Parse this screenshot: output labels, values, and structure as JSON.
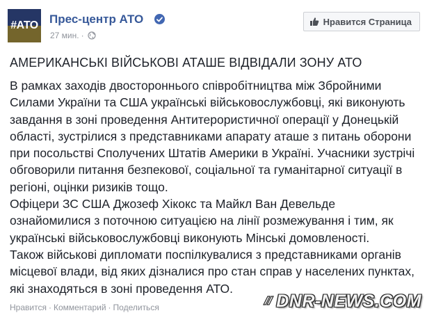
{
  "header": {
    "avatar_text": "#АТО",
    "page_name": "Прес-центр АТО",
    "verified_icon": "verified-badge-icon",
    "timestamp": "27 мин.",
    "separator": "·",
    "privacy_icon": "globe-icon",
    "like_page_label": "Нравится Страница"
  },
  "post": {
    "headline": "АМЕРИКАНСЬКІ ВІЙСЬКОВІ АТАШЕ ВІДВІДАЛИ ЗОНУ АТО",
    "lines": [
      "В рамках заходів двостороннього співробітництва між Збройними",
      "Силами України та США українські військовослужбовці, які виконують",
      "завдання в зоні проведення Антитерористичної операції у Донецькій",
      "області, зустрілися з представниками апарату аташе з питань оборони",
      "при посольстві Сполучених Штатів Америки в Україні. Учасники зустрічі",
      "обговорили питання безпекової, соціальної та гуманітарної ситуації в",
      "регіоні, оцінки ризиків тощо.",
      "Офіцери ЗС США Джозеф Хікокс та Майкл Ван Девельде",
      "ознайомилися з поточною ситуацією на лінії розмежування і тим, як",
      "українські військовослужбовці виконують Мінські домовленості.",
      "Також військові дипломати поспілкувалися з представниками органів",
      "місцевої влади, від яких дізналися про стан справ у населених пунктах,",
      "які знаходяться в зоні проведення АТО."
    ]
  },
  "actions": {
    "like": "Нравится",
    "comment": "Комментарий",
    "share": "Поделиться",
    "separator": "·"
  },
  "watermark": {
    "text": "DNR-NEWS.COM"
  },
  "colors": {
    "link": "#365899",
    "muted": "#90949c",
    "text": "#1d2129",
    "button_bg": "#f6f7f9"
  }
}
